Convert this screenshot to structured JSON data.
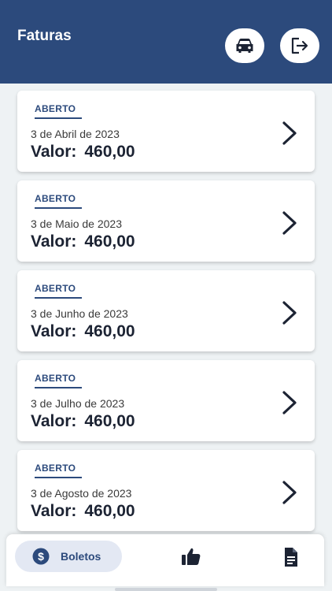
{
  "header": {
    "title": "Faturas",
    "car_icon": "car-icon",
    "logout_icon": "logout-icon"
  },
  "invoices": [
    {
      "status": "ABERTO",
      "date": "3 de Abril de 2023",
      "amount_label": "Valor:",
      "amount": "460,00"
    },
    {
      "status": "ABERTO",
      "date": "3 de Maio de 2023",
      "amount_label": "Valor:",
      "amount": "460,00"
    },
    {
      "status": "ABERTO",
      "date": "3 de Junho de 2023",
      "amount_label": "Valor:",
      "amount": "460,00"
    },
    {
      "status": "ABERTO",
      "date": "3 de Julho de 2023",
      "amount_label": "Valor:",
      "amount": "460,00"
    },
    {
      "status": "ABERTO",
      "date": "3 de Agosto de 2023",
      "amount_label": "Valor:",
      "amount": "460,00"
    }
  ],
  "bottom_nav": {
    "active_label": "Boletos",
    "items": [
      {
        "name": "boletos",
        "icon": "dollar-circle-icon",
        "label": "Boletos",
        "active": true
      },
      {
        "name": "like",
        "icon": "thumbs-up-icon",
        "label": "",
        "active": false
      },
      {
        "name": "document",
        "icon": "document-icon",
        "label": "",
        "active": false
      }
    ]
  },
  "colors": {
    "primary": "#2c4a7c",
    "background": "#eef2f4",
    "text_dark": "#1c2333"
  }
}
